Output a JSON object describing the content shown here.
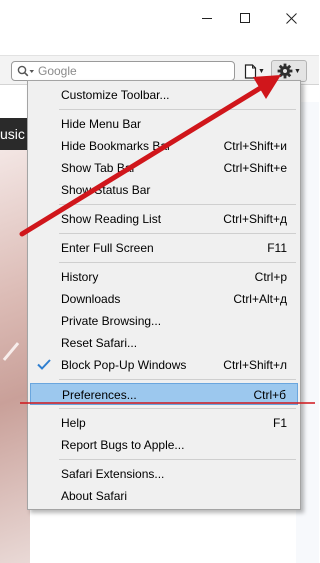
{
  "window": {
    "controls": {
      "minimize_icon": "minimize-icon",
      "maximize_icon": "maximize-icon",
      "close_icon": "close-icon"
    }
  },
  "toolbar": {
    "search_placeholder": "Google",
    "search_icon": "search-icon",
    "page_menu_icon": "page-icon",
    "gear_menu_icon": "gear-icon"
  },
  "background": {
    "tab_text": "usic"
  },
  "menu": {
    "items": [
      {
        "label": "Customize Toolbar...",
        "shortcut": ""
      },
      {
        "label": "Hide Menu Bar",
        "shortcut": ""
      },
      {
        "label": "Hide Bookmarks Bar",
        "shortcut": "Ctrl+Shift+и"
      },
      {
        "label": "Show Tab Bar",
        "shortcut": "Ctrl+Shift+е"
      },
      {
        "label": "Show Status Bar",
        "shortcut": ""
      },
      {
        "label": "Show Reading List",
        "shortcut": "Ctrl+Shift+д"
      },
      {
        "label": "Enter Full Screen",
        "shortcut": "F11"
      },
      {
        "label": "History",
        "shortcut": "Ctrl+р"
      },
      {
        "label": "Downloads",
        "shortcut": "Ctrl+Alt+д"
      },
      {
        "label": "Private Browsing...",
        "shortcut": ""
      },
      {
        "label": "Reset Safari...",
        "shortcut": ""
      },
      {
        "label": "Block Pop-Up Windows",
        "shortcut": "Ctrl+Shift+л",
        "checked": true
      },
      {
        "label": "Preferences...",
        "shortcut": "Ctrl+б",
        "highlighted": true
      },
      {
        "label": "Help",
        "shortcut": "F1"
      },
      {
        "label": "Report Bugs to Apple...",
        "shortcut": ""
      },
      {
        "label": "Safari Extensions...",
        "shortcut": ""
      },
      {
        "label": "About Safari",
        "shortcut": ""
      }
    ]
  },
  "annotation": {
    "color": "#d0161b"
  }
}
